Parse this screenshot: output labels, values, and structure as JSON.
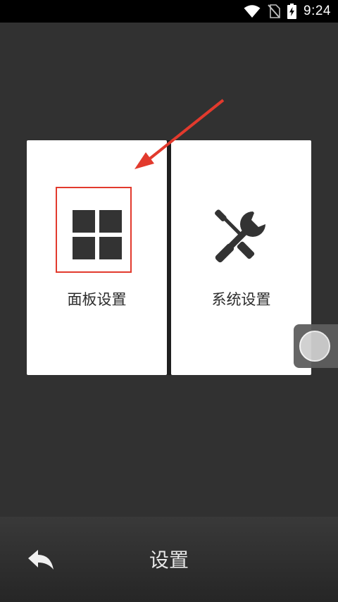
{
  "status_bar": {
    "time": "9:24",
    "icons": [
      "wifi-icon",
      "no-sim-icon",
      "battery-charging-icon"
    ]
  },
  "cards": [
    {
      "label": "面板设置",
      "icon": "grid-icon"
    },
    {
      "label": "系统设置",
      "icon": "tools-icon"
    }
  ],
  "bottom_bar": {
    "title": "设置",
    "back_icon": "back-arrow-icon"
  },
  "colors": {
    "background": "#313131",
    "card": "#ffffff",
    "highlight_border": "#e23a2d",
    "annotation_arrow": "#e23a2d"
  }
}
